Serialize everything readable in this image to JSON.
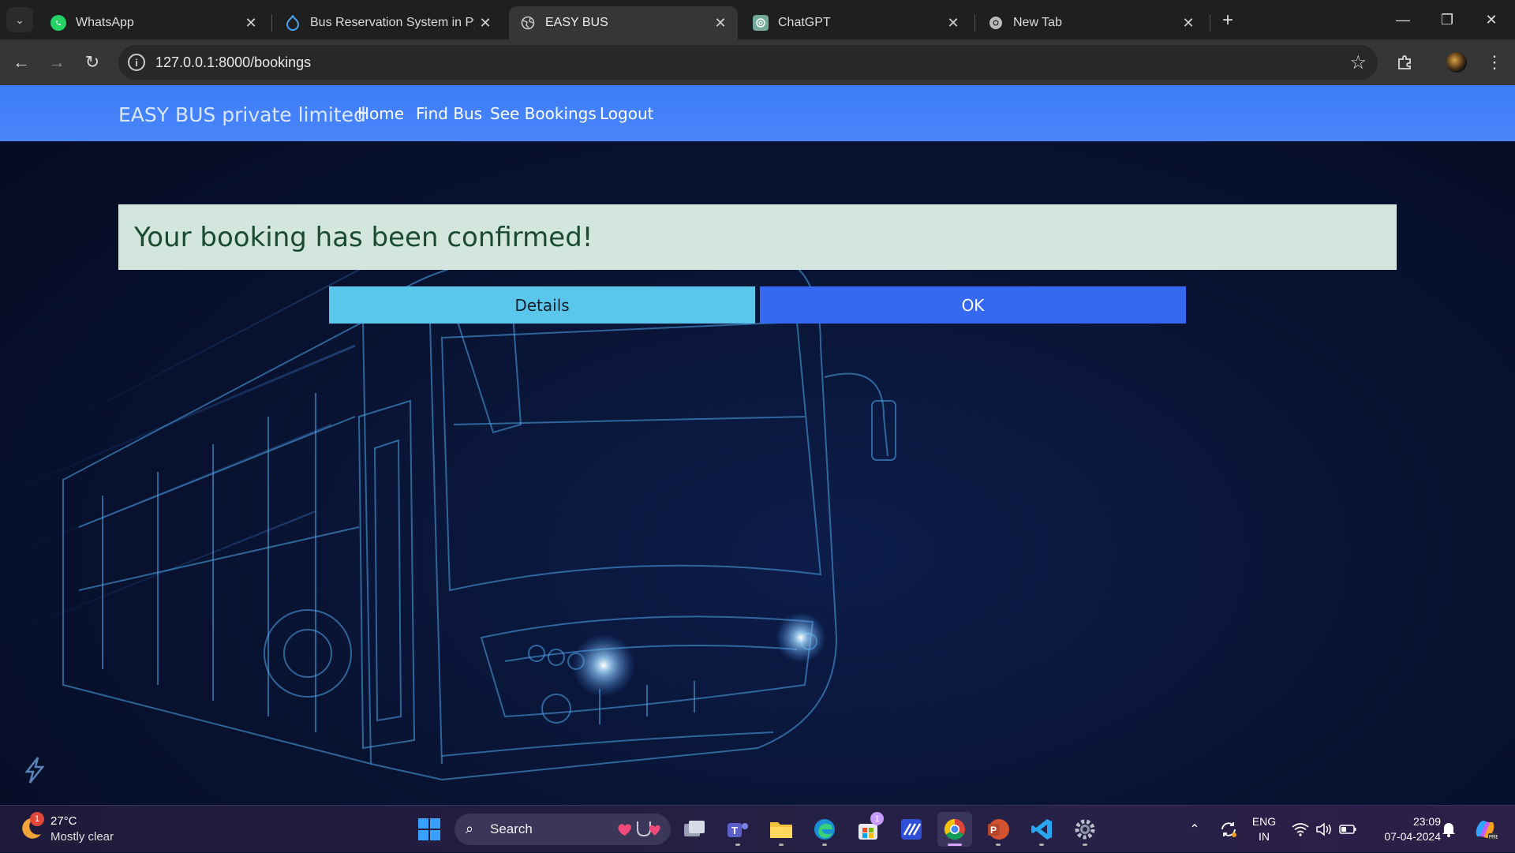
{
  "browser": {
    "tabs": [
      {
        "title": "WhatsApp",
        "icon": "whatsapp-icon",
        "active": false
      },
      {
        "title": "Bus Reservation System in Pyth",
        "icon": "drupal-icon",
        "active": false
      },
      {
        "title": "EASY BUS",
        "icon": "globe-icon",
        "active": true
      },
      {
        "title": "ChatGPT",
        "icon": "chatgpt-icon",
        "active": false
      },
      {
        "title": "New Tab",
        "icon": "chrome-icon",
        "active": false
      }
    ],
    "url": "127.0.0.1:8000/bookings"
  },
  "navbar": {
    "brand": "EASY BUS private limited",
    "links": [
      "Home",
      "Find Bus",
      "See Bookings",
      "Logout"
    ],
    "color": "#3d7cf7"
  },
  "alert": {
    "message": "Your booking has been confirmed!",
    "color": "#d3e6dd"
  },
  "actions": {
    "details_label": "Details",
    "ok_label": "OK"
  },
  "taskbar": {
    "weather": {
      "temp": "27°C",
      "desc": "Mostly clear",
      "badge": "1"
    },
    "search_label": "Search",
    "store_badge": "1",
    "lang": [
      "ENG",
      "IN"
    ],
    "time": "23:09",
    "date": "07-04-2024"
  }
}
